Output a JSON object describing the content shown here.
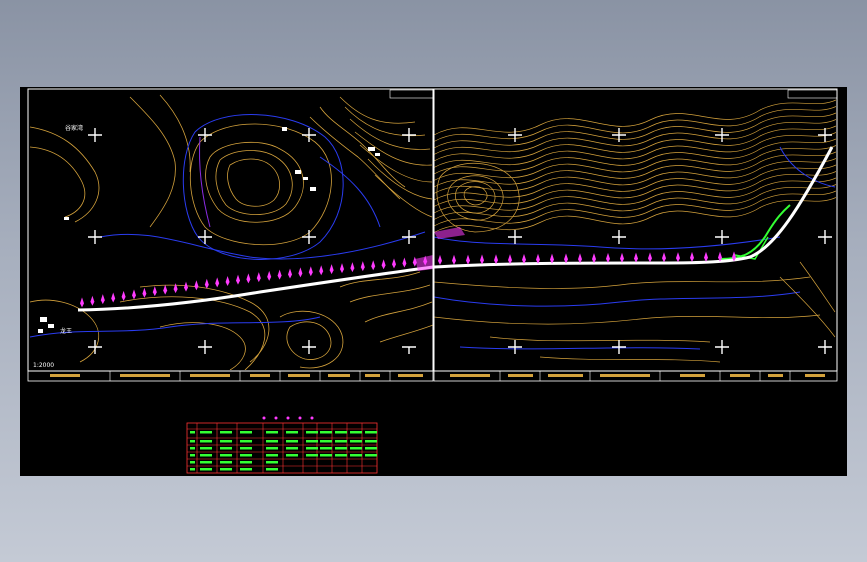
{
  "app": {
    "background_top": "#8a93a4",
    "background_bottom": "#c4cad5",
    "canvas_color": "#000000"
  },
  "drawing": {
    "colors": {
      "contour_major": "#d4a23c",
      "contour_minor": "#b07a20",
      "contour_blue": "#2a3cf0",
      "frame": "#ffffff",
      "road": "#ffffff",
      "markers": "#ff3cff",
      "green_alignment": "#33ff33",
      "table_grid": "#ff3333",
      "table_text": "#33ff33"
    },
    "scale_label": "1:2000",
    "place_labels": [
      "谷家湾",
      "龙王"
    ]
  }
}
